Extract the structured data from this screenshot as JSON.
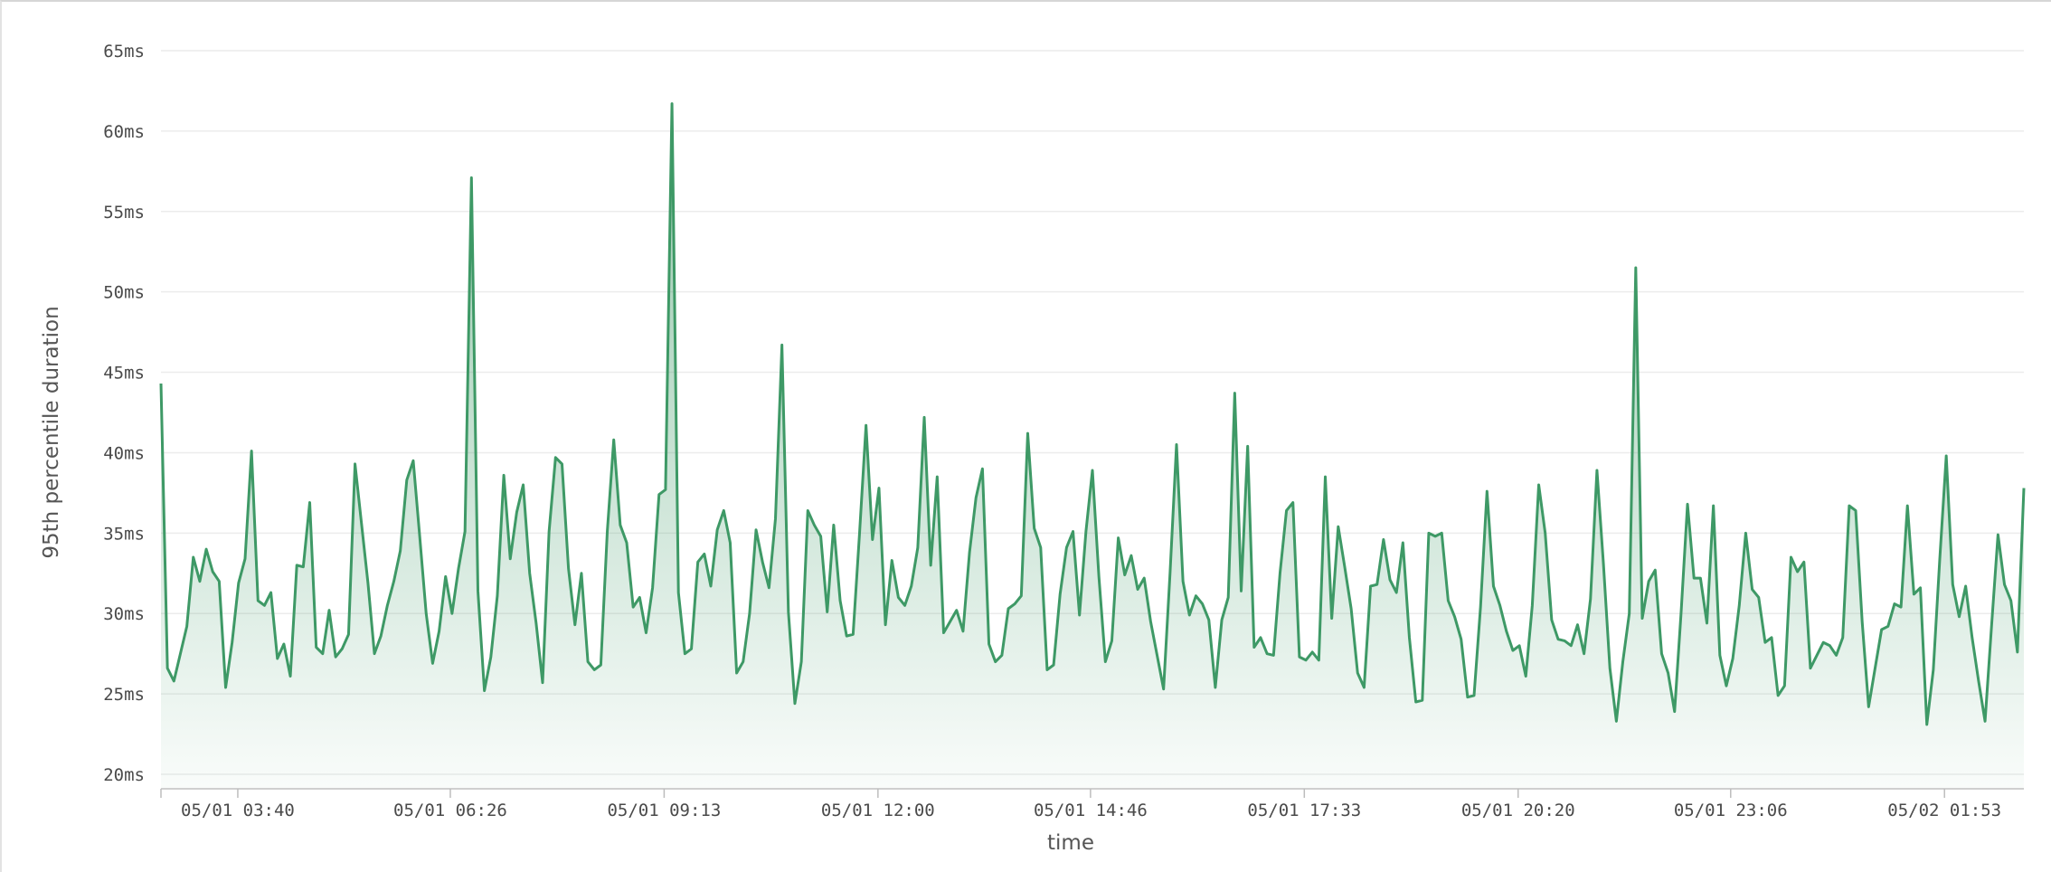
{
  "chart_data": {
    "type": "area",
    "ylabel": "95th percentile duration",
    "xlabel": "time",
    "y_unit": "ms",
    "ylim": [
      20,
      65
    ],
    "y_ticks": [
      "20ms",
      "25ms",
      "30ms",
      "35ms",
      "40ms",
      "45ms",
      "50ms",
      "55ms",
      "60ms",
      "65ms"
    ],
    "x_range": [
      "05/01 02:40",
      "05/02 02:55"
    ],
    "x_ticks": [
      "05/01 03:40",
      "05/01 06:26",
      "05/01 09:13",
      "05/01 12:00",
      "05/01 14:46",
      "05/01 17:33",
      "05/01 20:20",
      "05/01 23:06",
      "05/02 01:53"
    ],
    "grid": true,
    "colors": {
      "line": "#3e9966",
      "fill_top": "#3e9966",
      "grid": "#ececec"
    },
    "series": [
      {
        "values": [
          44.3,
          26.6,
          25.8,
          27.5,
          29.2,
          33.5,
          32.0,
          34.0,
          32.6,
          32.0,
          25.4,
          28.2,
          31.9,
          33.4,
          40.1,
          30.8,
          30.5,
          31.3,
          27.2,
          28.1,
          26.1,
          33.0,
          32.9,
          36.9,
          27.9,
          27.5,
          30.2,
          27.3,
          27.8,
          28.7,
          39.3,
          35.6,
          31.9,
          27.5,
          28.6,
          30.5,
          32.0,
          33.9,
          38.3,
          39.5,
          34.8,
          30.0,
          26.9,
          28.9,
          32.3,
          30.0,
          32.8,
          35.1,
          57.1,
          31.4,
          25.2,
          27.3,
          31.1,
          38.6,
          33.4,
          36.3,
          38.0,
          32.5,
          29.4,
          25.7,
          35.1,
          39.7,
          39.3,
          32.8,
          29.3,
          32.5,
          27.0,
          26.5,
          26.8,
          35.1,
          40.8,
          35.5,
          34.4,
          30.4,
          31.0,
          28.8,
          31.6,
          37.4,
          37.7,
          61.7,
          31.3,
          27.5,
          27.8,
          33.2,
          33.7,
          31.7,
          35.2,
          36.4,
          34.4,
          26.3,
          27.0,
          30.0,
          35.2,
          33.2,
          31.6,
          35.9,
          46.7,
          30.1,
          24.4,
          27.0,
          36.4,
          35.5,
          34.8,
          30.1,
          35.5,
          30.8,
          28.6,
          28.7,
          35.0,
          41.7,
          34.6,
          37.8,
          29.3,
          33.3,
          31.0,
          30.5,
          31.7,
          34.1,
          42.2,
          33.0,
          38.5,
          28.8,
          29.5,
          30.2,
          28.9,
          33.8,
          37.2,
          39.0,
          28.1,
          27.0,
          27.4,
          30.3,
          30.6,
          31.1,
          41.2,
          35.3,
          34.1,
          26.5,
          26.8,
          31.2,
          34.1,
          35.1,
          29.9,
          35.1,
          38.9,
          32.3,
          27.0,
          28.3,
          34.7,
          32.4,
          33.6,
          31.5,
          32.2,
          29.5,
          27.4,
          25.3,
          32.5,
          40.5,
          32.0,
          29.9,
          31.1,
          30.6,
          29.6,
          25.4,
          29.6,
          31.0,
          43.7,
          31.4,
          40.4,
          27.9,
          28.5,
          27.5,
          27.4,
          32.5,
          36.4,
          36.9,
          27.3,
          27.1,
          27.6,
          27.1,
          38.5,
          29.7,
          35.4,
          32.9,
          30.3,
          26.3,
          25.4,
          31.7,
          31.8,
          34.6,
          32.1,
          31.3,
          34.4,
          28.5,
          24.5,
          24.6,
          35.0,
          34.8,
          35.0,
          30.8,
          29.8,
          28.4,
          24.8,
          24.9,
          30.4,
          37.6,
          31.7,
          30.5,
          28.9,
          27.7,
          28.0,
          26.1,
          30.5,
          38.0,
          35.0,
          29.6,
          28.4,
          28.3,
          28.0,
          29.3,
          27.5,
          30.9,
          38.9,
          33.1,
          26.6,
          23.3,
          27.0,
          30.0,
          51.5,
          29.7,
          32.0,
          32.7,
          27.5,
          26.3,
          23.9,
          30.0,
          36.8,
          32.2,
          32.2,
          29.4,
          36.7,
          27.4,
          25.5,
          27.2,
          30.5,
          35.0,
          31.5,
          31.0,
          28.2,
          28.5,
          24.9,
          25.5,
          33.5,
          32.6,
          33.2,
          26.6,
          27.4,
          28.2,
          28.0,
          27.4,
          28.5,
          36.7,
          36.4,
          29.5,
          24.2,
          26.6,
          29.0,
          29.2,
          30.6,
          30.4,
          36.7,
          31.2,
          31.6,
          23.1,
          26.5,
          33.4,
          39.8,
          31.8,
          29.8,
          31.7,
          28.5,
          25.8,
          23.3,
          29.2,
          34.9,
          31.8,
          30.8,
          27.6,
          37.8
        ]
      }
    ]
  }
}
